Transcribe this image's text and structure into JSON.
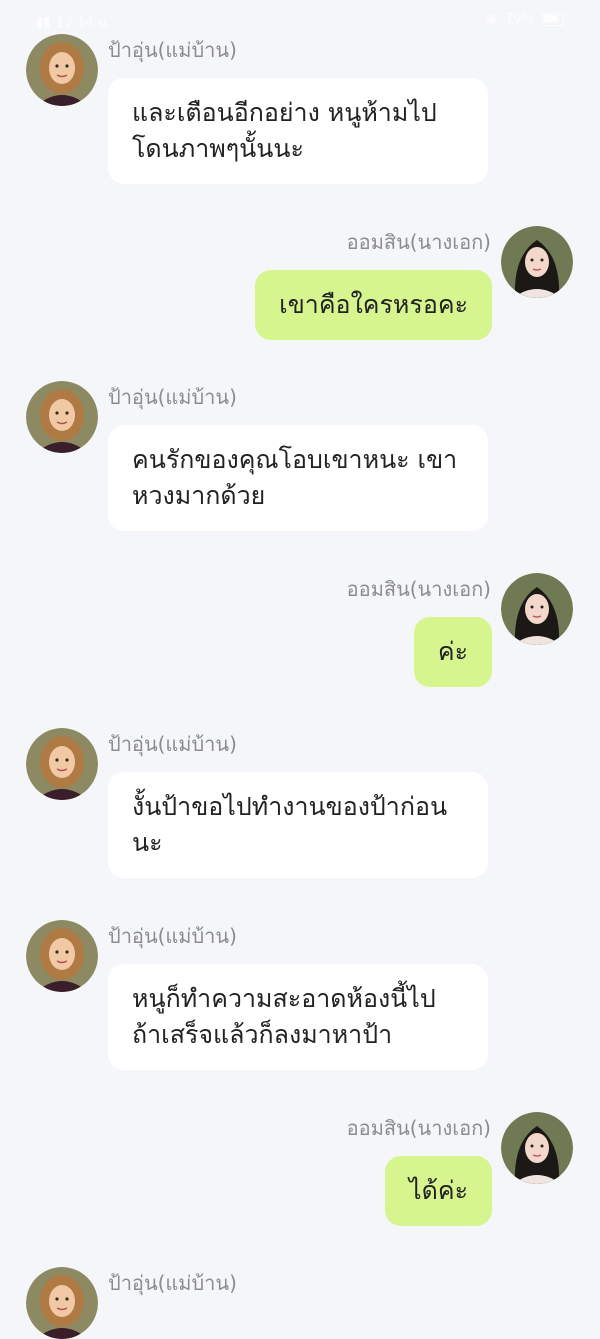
{
  "status_bar": {
    "time": "17:14 น.",
    "battery": "79%"
  },
  "messages": [
    {
      "side": "left",
      "sender": "ป้าอุ่น(แม่บ้าน)",
      "text": "และเตือนอีกอย่าง หนูห้ามไปโดนภาพๆนั้นนะ"
    },
    {
      "side": "right",
      "sender": "ออมสิน(นางเอก)",
      "text": "เขาคือใครหรอคะ"
    },
    {
      "side": "left",
      "sender": "ป้าอุ่น(แม่บ้าน)",
      "text": "คนรักของคุณโอบเขาหนะ เขาหวงมากด้วย"
    },
    {
      "side": "right",
      "sender": "ออมสิน(นางเอก)",
      "text": "ค่ะ"
    },
    {
      "side": "left",
      "sender": "ป้าอุ่น(แม่บ้าน)",
      "text": "งั้นป้าขอไปทำงานของป้าก่อนนะ"
    },
    {
      "side": "left",
      "sender": "ป้าอุ่น(แม่บ้าน)",
      "text": "หนูก็ทำความสะอาดห้องนี้ไปถ้าเสร็จแล้วก็ลงมาหาป้า"
    },
    {
      "side": "right",
      "sender": "ออมสิน(นางเอก)",
      "text": "ได้ค่ะ"
    },
    {
      "side": "left",
      "sender": "ป้าอุ่น(แม่บ้าน)",
      "text": ""
    }
  ],
  "colors": {
    "background": "#f4f6f9",
    "left_bubble": "#ffffff",
    "right_bubble": "#d6f58f",
    "name_text": "#8c8c8c"
  },
  "icons": {
    "maid_avatar": "curly-haired-woman-avatar",
    "heroine_avatar": "long-dark-haired-girl-avatar"
  }
}
